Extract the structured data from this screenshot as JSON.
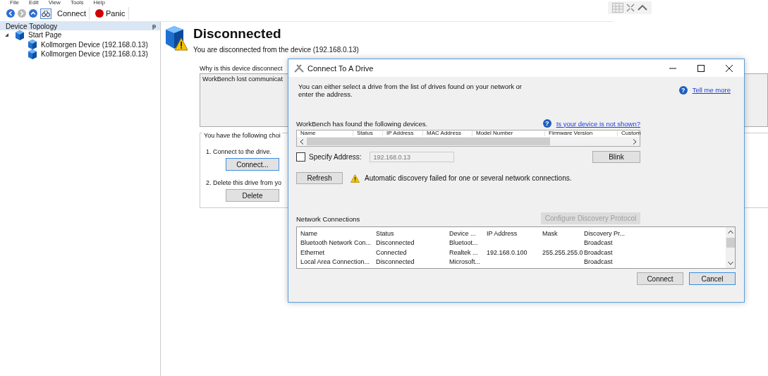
{
  "menu": [
    "File",
    "Edit",
    "View",
    "Tools",
    "Help"
  ],
  "toolbar": {
    "connect": "Connect",
    "panic": "Panic"
  },
  "sidebar": {
    "title": "Device Topology",
    "pin": "ᵽ",
    "tree": [
      {
        "label": "Start Page",
        "expanded": true,
        "children": [
          {
            "label": "Kollmorgen Device (192.168.0.13)"
          },
          {
            "label": "Kollmorgen Device (192.168.0.13)"
          }
        ]
      }
    ]
  },
  "page": {
    "title": "Disconnected",
    "subtitle": "You are disconnected from the device (192.168.0.13)",
    "why_label": "Why is this device disconnect",
    "reason": "WorkBench lost communicat",
    "choices_label": "You have the following choi",
    "choices": [
      {
        "text": "1. Connect to the drive.",
        "button": "Connect..."
      },
      {
        "text": "2. Delete this drive from yo",
        "button": "Delete"
      }
    ]
  },
  "dialog": {
    "title": "Connect To A Drive",
    "intro": "You can either select a drive from the list of drives found on your network or enter the address.",
    "tell_more_icon": "?",
    "tell_more": "Tell me more",
    "not_shown_icon": "?",
    "found_label": "WorkBench has found the following devices.",
    "not_shown": "Is your device is not shown?",
    "device_columns": [
      "Name",
      "Status",
      "IP Address",
      "MAC Address",
      "Model Number",
      "Firmware Version",
      "Custom"
    ],
    "specify": {
      "label": "Specify Address:",
      "checked": false,
      "value": "192.168.0.13"
    },
    "blink": "Blink",
    "refresh": "Refresh",
    "warning": "Automatic discovery failed for one or several network connections.",
    "network_label": "Network Connections",
    "configure": {
      "label": "Configure Discovery Protocol",
      "disabled": true
    },
    "network_columns": [
      "Name",
      "Status",
      "Device ...",
      "IP Address",
      "Mask",
      "Discovery Pr..."
    ],
    "network_rows": [
      [
        "Bluetooth Network Con...",
        "Disconnected",
        "Bluetoot...",
        "",
        "",
        "Broadcast"
      ],
      [
        "Ethernet",
        "Connected",
        "Realtek ...",
        "192.168.0.100",
        "255.255.255.0",
        "Broadcast"
      ],
      [
        "Local Area Connection...",
        "Disconnected",
        "Microsoft...",
        "",
        "",
        "Broadcast"
      ]
    ],
    "buttons": [
      {
        "label": "Connect",
        "default": false
      },
      {
        "label": "Cancel",
        "default": true
      }
    ]
  }
}
